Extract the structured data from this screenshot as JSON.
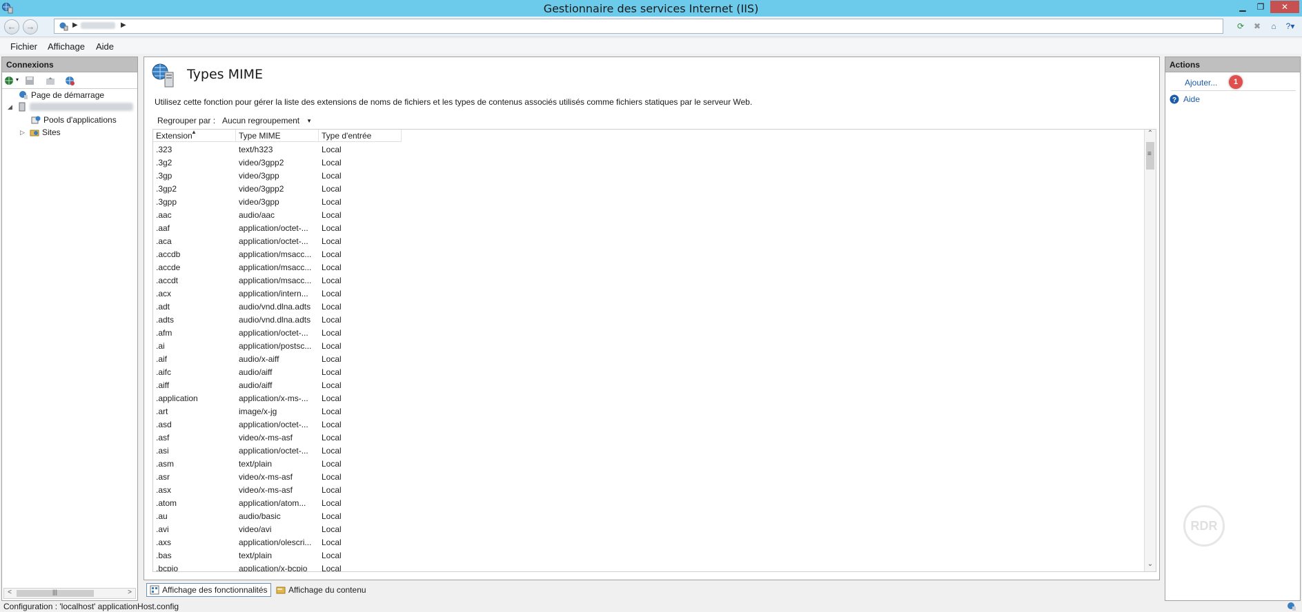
{
  "window": {
    "title": "Gestionnaire des services Internet (IIS)"
  },
  "menu": {
    "file": "Fichier",
    "view": "Affichage",
    "help": "Aide"
  },
  "connections": {
    "header": "Connexions",
    "tree": {
      "start_page": "Page de démarrage",
      "app_pools": "Pools d'applications",
      "sites": "Sites"
    }
  },
  "main": {
    "title": "Types MIME",
    "description": "Utilisez cette fonction pour gérer la liste des extensions de noms de fichiers et les types de contenus associés utilisés comme fichiers statiques par le serveur Web.",
    "group_by_label": "Regrouper par :",
    "group_by_value": "Aucun regroupement",
    "columns": [
      "Extension",
      "Type MIME",
      "Type d'entrée"
    ],
    "rows": [
      [
        ".323",
        "text/h323",
        "Local"
      ],
      [
        ".3g2",
        "video/3gpp2",
        "Local"
      ],
      [
        ".3gp",
        "video/3gpp",
        "Local"
      ],
      [
        ".3gp2",
        "video/3gpp2",
        "Local"
      ],
      [
        ".3gpp",
        "video/3gpp",
        "Local"
      ],
      [
        ".aac",
        "audio/aac",
        "Local"
      ],
      [
        ".aaf",
        "application/octet-...",
        "Local"
      ],
      [
        ".aca",
        "application/octet-...",
        "Local"
      ],
      [
        ".accdb",
        "application/msacc...",
        "Local"
      ],
      [
        ".accde",
        "application/msacc...",
        "Local"
      ],
      [
        ".accdt",
        "application/msacc...",
        "Local"
      ],
      [
        ".acx",
        "application/intern...",
        "Local"
      ],
      [
        ".adt",
        "audio/vnd.dlna.adts",
        "Local"
      ],
      [
        ".adts",
        "audio/vnd.dlna.adts",
        "Local"
      ],
      [
        ".afm",
        "application/octet-...",
        "Local"
      ],
      [
        ".ai",
        "application/postsc...",
        "Local"
      ],
      [
        ".aif",
        "audio/x-aiff",
        "Local"
      ],
      [
        ".aifc",
        "audio/aiff",
        "Local"
      ],
      [
        ".aiff",
        "audio/aiff",
        "Local"
      ],
      [
        ".application",
        "application/x-ms-...",
        "Local"
      ],
      [
        ".art",
        "image/x-jg",
        "Local"
      ],
      [
        ".asd",
        "application/octet-...",
        "Local"
      ],
      [
        ".asf",
        "video/x-ms-asf",
        "Local"
      ],
      [
        ".asi",
        "application/octet-...",
        "Local"
      ],
      [
        ".asm",
        "text/plain",
        "Local"
      ],
      [
        ".asr",
        "video/x-ms-asf",
        "Local"
      ],
      [
        ".asx",
        "video/x-ms-asf",
        "Local"
      ],
      [
        ".atom",
        "application/atom...",
        "Local"
      ],
      [
        ".au",
        "audio/basic",
        "Local"
      ],
      [
        ".avi",
        "video/avi",
        "Local"
      ],
      [
        ".axs",
        "application/olescri...",
        "Local"
      ],
      [
        ".bas",
        "text/plain",
        "Local"
      ],
      [
        ".bcpio",
        "application/x-bcpio",
        "Local"
      ]
    ]
  },
  "view_tabs": {
    "features": "Affichage des fonctionnalités",
    "content": "Affichage du contenu"
  },
  "actions": {
    "header": "Actions",
    "add": "Ajouter...",
    "help": "Aide",
    "badge": "1"
  },
  "status": {
    "text": "Configuration : 'localhost' applicationHost.config"
  },
  "icons": {
    "app": "iis-globe-server-icon",
    "close": "close-icon",
    "minimize": "minimize-icon",
    "restore": "restore-icon"
  },
  "colors": {
    "titlebar": "#6ccbea",
    "link": "#1c5ba8",
    "badge": "#e04e4e"
  }
}
